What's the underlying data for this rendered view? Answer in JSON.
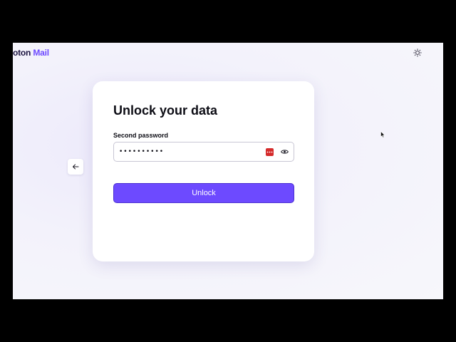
{
  "header": {
    "logo_brand": "oton",
    "logo_product": "Mail",
    "theme_toggle_icon": "sun-icon"
  },
  "nav": {
    "back_icon": "arrow-left-icon"
  },
  "card": {
    "title": "Unlock your data",
    "password_label": "Second password",
    "password_value": "••••••••••",
    "password_manager_icon": "password-manager-icon",
    "visibility_icon": "eye-icon",
    "unlock_label": "Unlock"
  },
  "colors": {
    "accent": "#6d4aff",
    "accent_border": "#4a2fd1",
    "password_manager": "#d52b2b",
    "text": "#0c0c14"
  }
}
